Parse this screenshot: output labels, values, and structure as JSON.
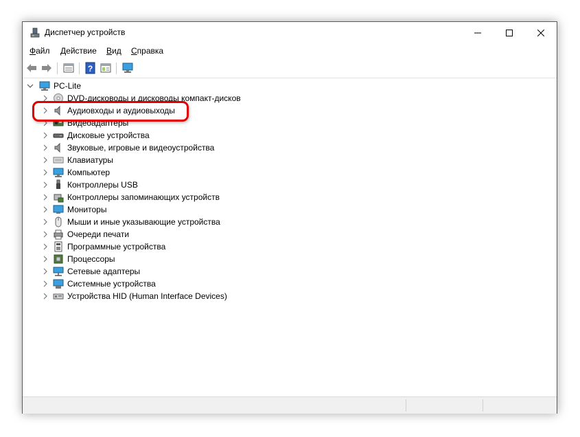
{
  "window": {
    "title": "Диспетчер устройств"
  },
  "menu": [
    {
      "label": "Файл",
      "mnemonic": "Ф"
    },
    {
      "label": "Действие",
      "mnemonic": "Д"
    },
    {
      "label": "Вид",
      "mnemonic": "В"
    },
    {
      "label": "Справка",
      "mnemonic": "С"
    }
  ],
  "tree": {
    "root": "PC-Lite",
    "items": [
      {
        "label": "DVD-дисководы и дисководы компакт-дисков",
        "icon": "dvd-drive-icon"
      },
      {
        "label": "Аудиовходы и аудиовыходы",
        "icon": "speaker-icon",
        "highlighted": true
      },
      {
        "label": "Видеоадаптеры",
        "icon": "display-adapter-icon"
      },
      {
        "label": "Дисковые устройства",
        "icon": "disk-drive-icon"
      },
      {
        "label": "Звуковые, игровые и видеоустройства",
        "icon": "speaker-icon"
      },
      {
        "label": "Клавиатуры",
        "icon": "keyboard-icon"
      },
      {
        "label": "Компьютер",
        "icon": "computer-icon"
      },
      {
        "label": "Контроллеры USB",
        "icon": "usb-icon"
      },
      {
        "label": "Контроллеры запоминающих устройств",
        "icon": "storage-controller-icon"
      },
      {
        "label": "Мониторы",
        "icon": "monitor-icon"
      },
      {
        "label": "Мыши и иные указывающие устройства",
        "icon": "mouse-icon"
      },
      {
        "label": "Очереди печати",
        "icon": "printer-icon"
      },
      {
        "label": "Программные устройства",
        "icon": "software-device-icon"
      },
      {
        "label": "Процессоры",
        "icon": "processor-icon"
      },
      {
        "label": "Сетевые адаптеры",
        "icon": "network-adapter-icon"
      },
      {
        "label": "Системные устройства",
        "icon": "system-device-icon"
      },
      {
        "label": "Устройства HID (Human Interface Devices)",
        "icon": "hid-icon"
      }
    ]
  },
  "colors": {
    "highlight": "#e00000",
    "accent": "#2e7bcf"
  }
}
